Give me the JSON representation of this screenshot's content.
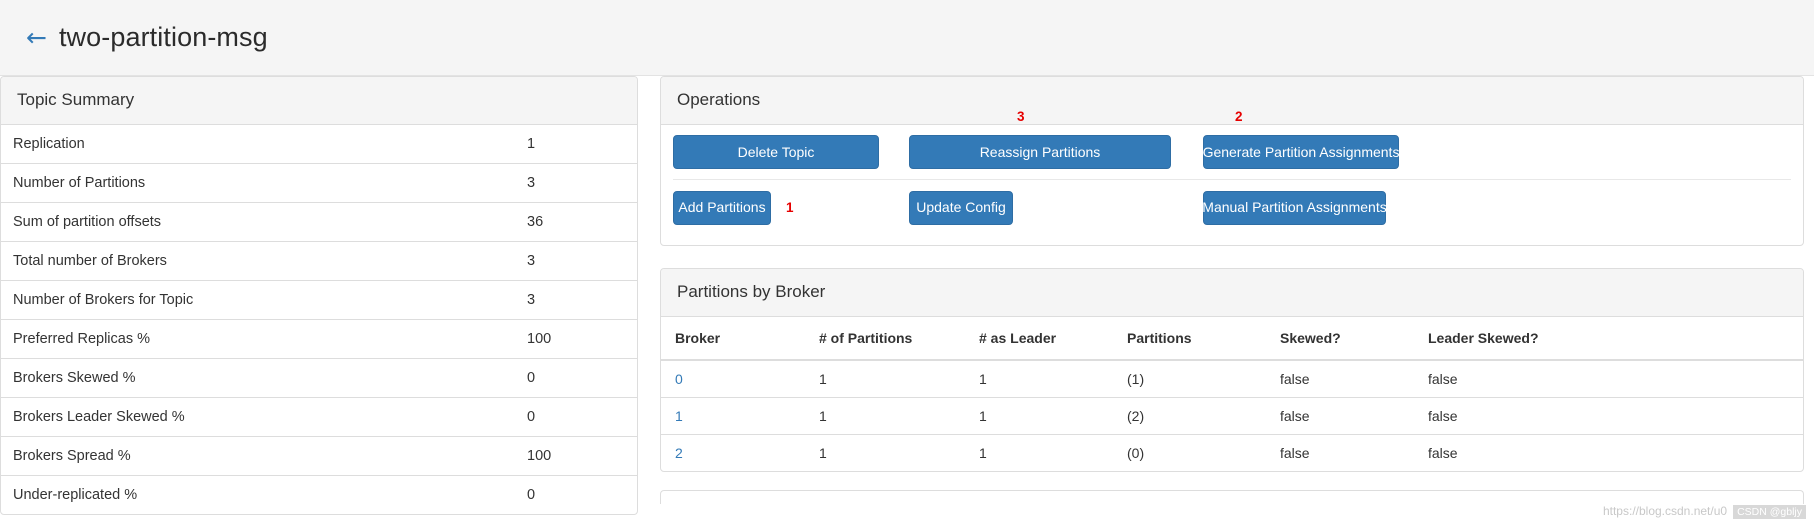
{
  "header": {
    "back_icon": "arrow-left-icon",
    "title": "two-partition-msg"
  },
  "topic_summary": {
    "title": "Topic Summary",
    "rows": [
      {
        "label": "Replication",
        "value": "1"
      },
      {
        "label": "Number of Partitions",
        "value": "3"
      },
      {
        "label": "Sum of partition offsets",
        "value": "36"
      },
      {
        "label": "Total number of Brokers",
        "value": "3"
      },
      {
        "label": "Number of Brokers for Topic",
        "value": "3"
      },
      {
        "label": "Preferred Replicas %",
        "value": "100"
      },
      {
        "label": "Brokers Skewed %",
        "value": "0"
      },
      {
        "label": "Brokers Leader Skewed %",
        "value": "0"
      },
      {
        "label": "Brokers Spread %",
        "value": "100"
      },
      {
        "label": "Under-replicated %",
        "value": "0"
      }
    ]
  },
  "operations": {
    "title": "Operations",
    "buttons": {
      "delete_topic": "Delete Topic",
      "reassign_partitions": "Reassign Partitions",
      "generate_partition_assignments": "Generate Partition Assignments",
      "add_partitions": "Add Partitions",
      "update_config": "Update Config",
      "manual_partition_assignments": "Manual Partition Assignments"
    },
    "annotations": {
      "add_partitions_step": "1",
      "generate_step": "2",
      "reassign_step": "3"
    }
  },
  "partitions_by_broker": {
    "title": "Partitions by Broker",
    "columns": [
      "Broker",
      "# of Partitions",
      "# as Leader",
      "Partitions",
      "Skewed?",
      "Leader Skewed?"
    ],
    "rows": [
      {
        "broker": "0",
        "num_partitions": "1",
        "num_as_leader": "1",
        "partitions": "(1)",
        "skewed": "false",
        "leader_skewed": "false"
      },
      {
        "broker": "1",
        "num_partitions": "1",
        "num_as_leader": "1",
        "partitions": "(2)",
        "skewed": "false",
        "leader_skewed": "false"
      },
      {
        "broker": "2",
        "num_partitions": "1",
        "num_as_leader": "1",
        "partitions": "(0)",
        "skewed": "false",
        "leader_skewed": "false"
      }
    ]
  },
  "watermark": {
    "url": "https://blog.csdn.net/u0",
    "tag": "CSDN @gbljy"
  },
  "colors": {
    "primary_button": "#337ab7",
    "primary_button_border": "#2e6da4",
    "annotation_red": "#e60000",
    "link": "#337ab7",
    "panel_heading_bg": "#f5f5f5",
    "panel_border": "#dddddd"
  }
}
